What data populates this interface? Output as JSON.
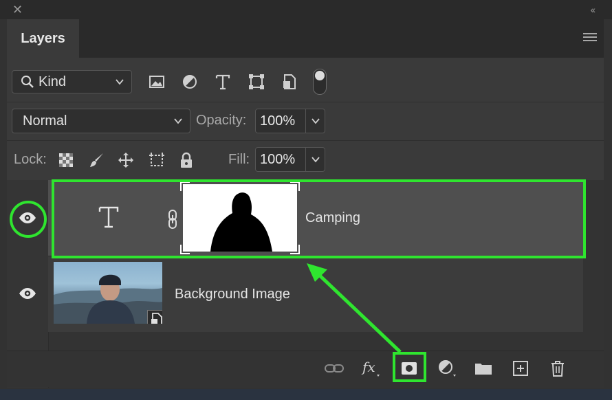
{
  "panel": {
    "title": "Layers",
    "close_icon": "close-icon",
    "collapse_icon": "double-chevron-left-icon",
    "menu_icon": "hamburger-menu-icon"
  },
  "filter": {
    "kind_label": "Kind",
    "icons": [
      "image-filter-icon",
      "adjustment-filter-icon",
      "type-filter-icon",
      "shape-filter-icon",
      "smart-object-filter-icon"
    ]
  },
  "blend": {
    "mode": "Normal",
    "opacity_label": "Opacity:",
    "opacity_value": "100%"
  },
  "lock": {
    "label": "Lock:",
    "fill_label": "Fill:",
    "fill_value": "100%",
    "icons": [
      "lock-transparent-pixels-icon",
      "lock-image-pixels-icon",
      "lock-position-icon",
      "prevent-auto-nesting-icon",
      "lock-all-icon"
    ]
  },
  "layers": [
    {
      "name": "Camping",
      "type": "text",
      "selected": true
    },
    {
      "name": "Background Image",
      "type": "smart-object",
      "selected": false
    }
  ],
  "footer_icons": [
    "link-layers-icon",
    "fx-icon",
    "add-mask-icon",
    "adjustment-layer-icon",
    "group-folder-icon",
    "new-layer-icon",
    "trash-icon"
  ],
  "accent": {
    "highlight": "#2fe52f",
    "panel": "#323232"
  }
}
